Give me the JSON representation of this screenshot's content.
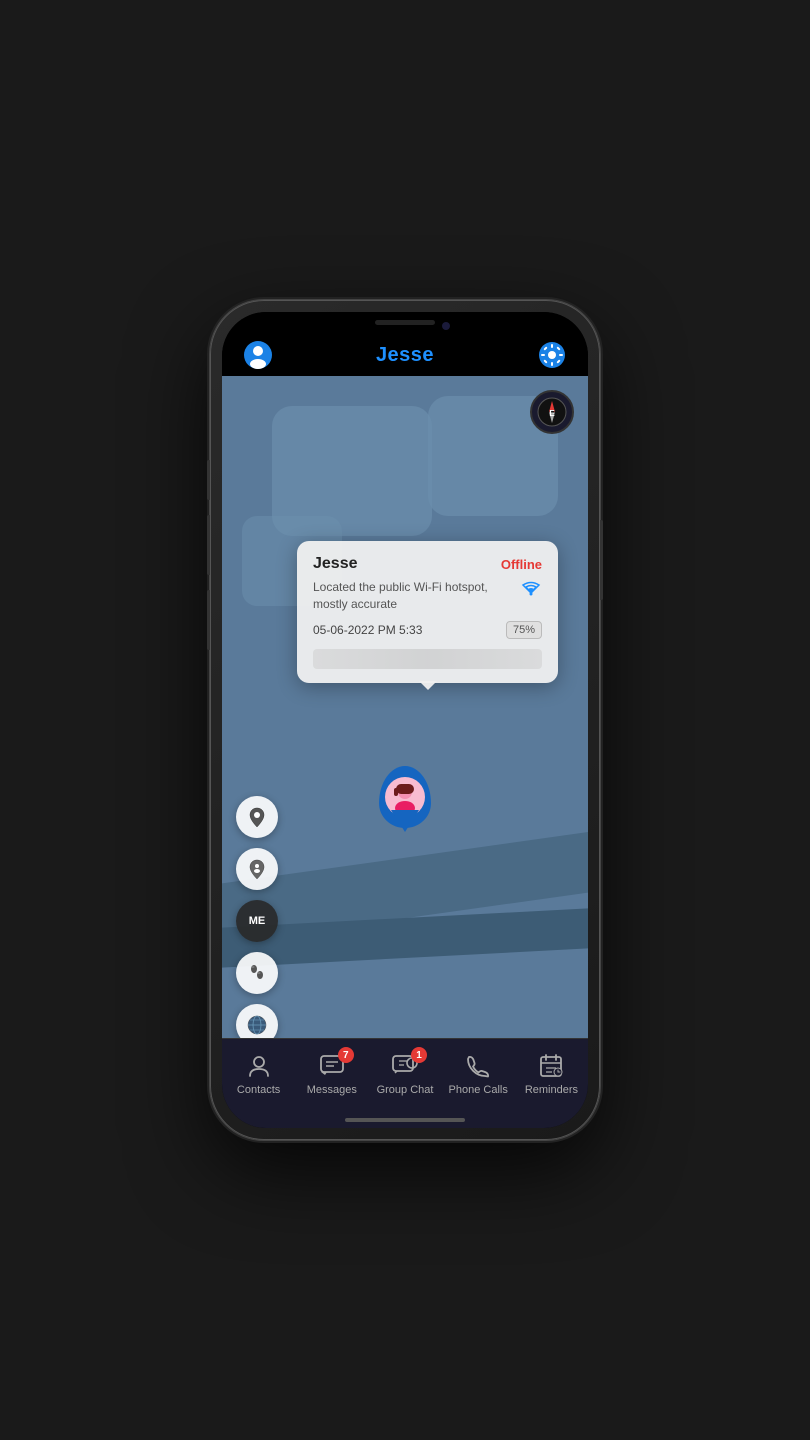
{
  "phone": {
    "title": "Jesse"
  },
  "header": {
    "title": "Jesse",
    "profile_icon": "👤",
    "settings_icon": "⚙"
  },
  "compass": {
    "label": "E"
  },
  "info_popup": {
    "name": "Jesse",
    "status": "Offline",
    "location_text": "Located the public Wi-Fi hotspot, mostly accurate",
    "datetime": "05-06-2022 PM 5:33",
    "battery": "75%"
  },
  "side_buttons": [
    {
      "icon": "📍",
      "label": "location",
      "type": "light"
    },
    {
      "icon": "📍",
      "label": "location-2",
      "type": "light"
    },
    {
      "icon": "ME",
      "label": "me",
      "type": "dark"
    },
    {
      "icon": "👣",
      "label": "footprints",
      "type": "light"
    },
    {
      "icon": "🌍",
      "label": "globe",
      "type": "light"
    }
  ],
  "tab_bar": {
    "items": [
      {
        "id": "contacts",
        "label": "Contacts",
        "icon": "person",
        "badge": null
      },
      {
        "id": "messages",
        "label": "Messages",
        "icon": "message",
        "badge": "7"
      },
      {
        "id": "group-chat",
        "label": "Group Chat",
        "icon": "group-message",
        "badge": "1"
      },
      {
        "id": "phone-calls",
        "label": "Phone Calls",
        "icon": "phone",
        "badge": null
      },
      {
        "id": "reminders",
        "label": "Reminders",
        "icon": "calendar",
        "badge": null
      }
    ]
  }
}
